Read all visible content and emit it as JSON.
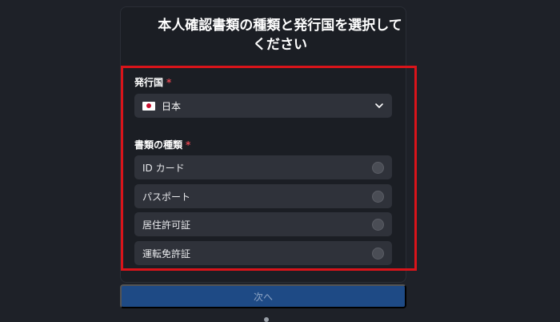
{
  "title": {
    "line1": "本人確認書類の種類と発行国を選択して",
    "line2": "ください"
  },
  "country": {
    "label": "発行国",
    "required_mark": "*",
    "selected": "日本",
    "flag_icon": "japan-flag-icon"
  },
  "document_type": {
    "label": "書類の種類",
    "required_mark": "*",
    "options": [
      {
        "label": "ID カード",
        "selected": false
      },
      {
        "label": "パスポート",
        "selected": false
      },
      {
        "label": "居住許可証",
        "selected": false
      },
      {
        "label": "運転免許証",
        "selected": false
      }
    ]
  },
  "next_button": {
    "label": "次へ"
  },
  "colors": {
    "background": "#1e2128",
    "field": "#2f323a",
    "highlight": "#d9141a",
    "button": "#1e4a85",
    "required": "#e0454f"
  }
}
